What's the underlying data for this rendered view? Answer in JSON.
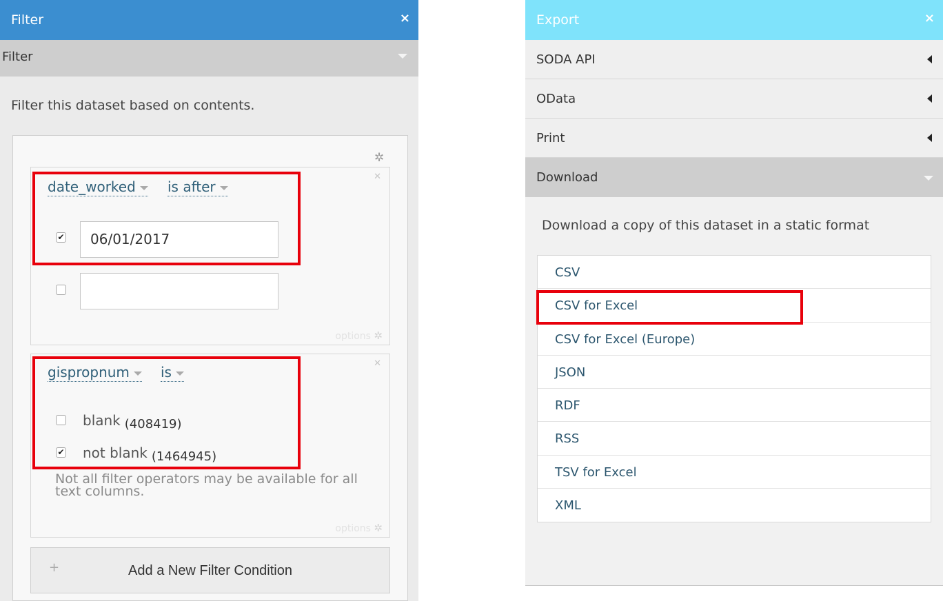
{
  "filter_panel": {
    "title": "Filter",
    "close_glyph": "×",
    "section_label": "Filter",
    "description": "Filter this dataset based on contents.",
    "condition1": {
      "column": "date_worked",
      "operator": "is after",
      "row1": {
        "checked": true,
        "value": "06/01/2017"
      },
      "row2": {
        "checked": false,
        "value": ""
      },
      "options_label": "options"
    },
    "condition2": {
      "column": "gispropnum",
      "operator": "is",
      "options": [
        {
          "label": "blank",
          "count": "(408419)",
          "checked": false
        },
        {
          "label": "not blank",
          "count": "(1464945)",
          "checked": true
        }
      ],
      "note": "Not all filter operators may be available for all text columns.",
      "options_label": "options"
    },
    "add_button": {
      "plus": "+",
      "label": "Add a New Filter Condition"
    }
  },
  "export_panel": {
    "title": "Export",
    "close_glyph": "×",
    "sections": [
      {
        "label": "SODA API",
        "expanded": false
      },
      {
        "label": "OData",
        "expanded": false
      },
      {
        "label": "Print",
        "expanded": false
      },
      {
        "label": "Download",
        "expanded": true
      }
    ],
    "download_description": "Download a copy of this dataset in a static format",
    "formats": [
      "CSV",
      "CSV for Excel",
      "CSV for Excel (Europe)",
      "JSON",
      "RDF",
      "RSS",
      "TSV for Excel",
      "XML"
    ]
  },
  "icons": {
    "gear": "gear-icon",
    "close": "close-icon",
    "checkbox": "checkbox-icon"
  },
  "colors": {
    "filter_titlebar": "#3b8ed0",
    "export_titlebar": "#7fe3fb",
    "link": "#2c566e",
    "highlight": "#e8000b"
  }
}
